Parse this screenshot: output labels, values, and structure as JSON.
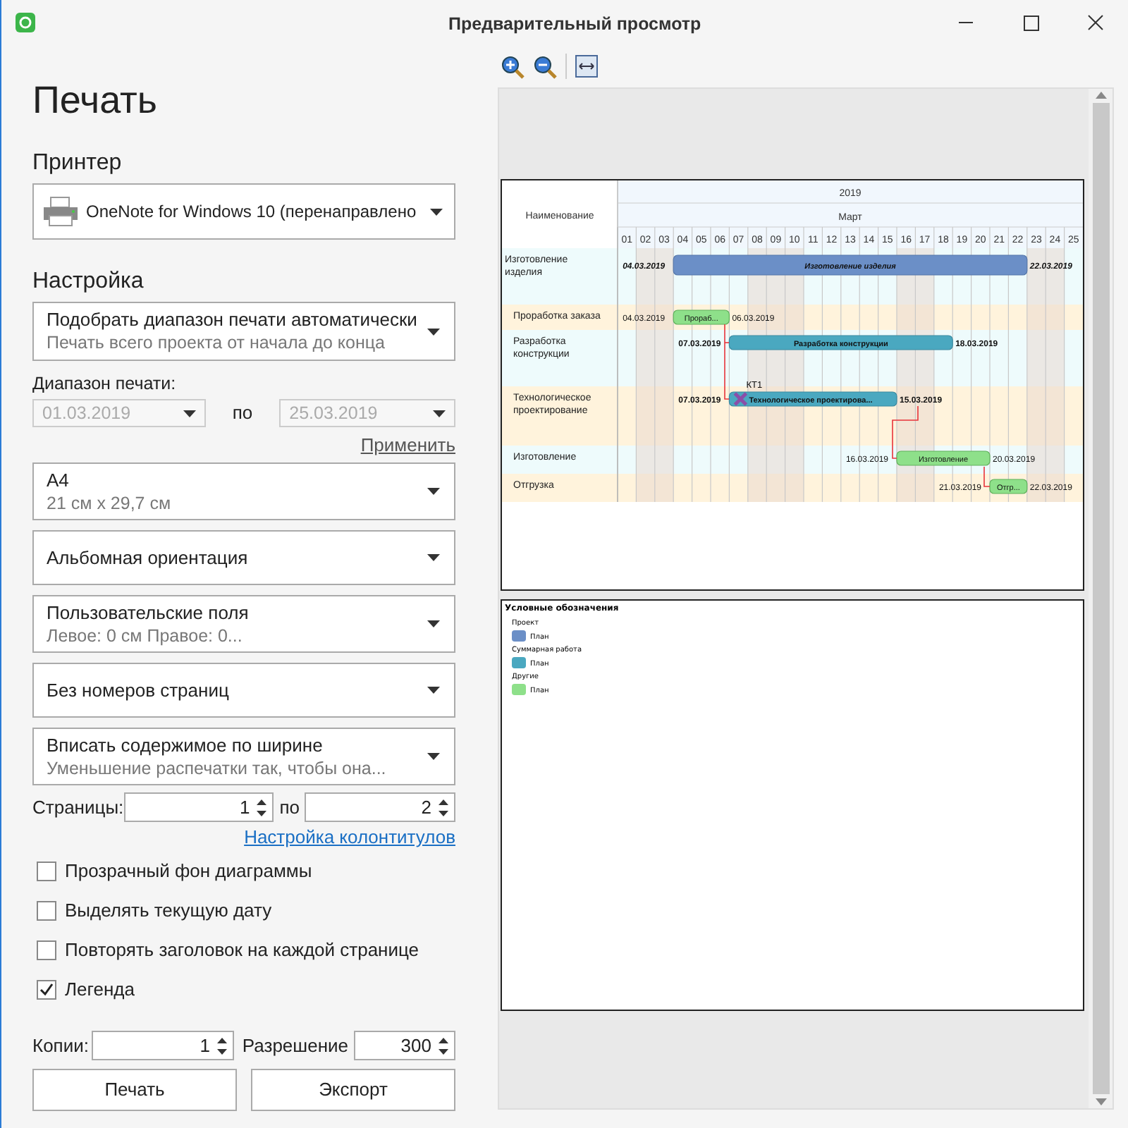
{
  "window": {
    "title": "Предварительный просмотр"
  },
  "panel": {
    "heading": "Печать",
    "printer_label": "Принтер",
    "printer": "OneNote for Windows 10 (перенаправлено",
    "settings_label": "Настройка",
    "scope": {
      "title": "Подобрать диапазон печати автоматически",
      "subtitle": "Печать всего проекта от начала до конца"
    },
    "range": {
      "label": "Диапазон печати:",
      "from": "01.03.2019",
      "separator": "по",
      "to": "25.03.2019",
      "disabled": true
    },
    "apply_link": "Применить",
    "dropdowns": [
      {
        "title": "A4",
        "subtitle": "21 см x 29,7 см"
      },
      {
        "title": "Альбомная ориентация"
      },
      {
        "title": "Пользовательские поля",
        "subtitle": "Левое:  0 см    Правое:  0..."
      },
      {
        "title": "Без номеров страниц"
      },
      {
        "title": "Вписать содержимое по ширине",
        "subtitle": "Уменьшение распечатки так, чтобы она..."
      }
    ],
    "pages": {
      "label": "Страницы:",
      "from": "1",
      "separator": "по",
      "to": "2"
    },
    "headers_link": "Настройка колонтитулов",
    "checkboxes": [
      {
        "label": "Прозрачный фон диаграммы",
        "checked": false
      },
      {
        "label": "Выделять текущую дату",
        "checked": false
      },
      {
        "label": "Повторять заголовок на каждой странице",
        "checked": false
      },
      {
        "label": "Легенда",
        "checked": true
      }
    ],
    "copies": {
      "label": "Копии:",
      "value": "1"
    },
    "resolution": {
      "label": "Разрешение",
      "value": "300"
    },
    "buttons": [
      "Печать",
      "Экспорт"
    ]
  },
  "preview": {
    "gantt": {
      "name_header": "Наименование",
      "year": "2019",
      "month": "Март",
      "days": [
        "01",
        "02",
        "03",
        "04",
        "05",
        "06",
        "07",
        "08",
        "09",
        "10",
        "11",
        "12",
        "13",
        "14",
        "15",
        "16",
        "17",
        "18",
        "19",
        "20",
        "21",
        "22",
        "23",
        "24",
        "25"
      ],
      "tasks": [
        {
          "kind": "project",
          "name": "Изготовление изделия",
          "start": "04.03.2019",
          "label": "Изготовление изделия",
          "end": "22.03.2019"
        },
        {
          "kind": "task",
          "name": "Проработка заказа",
          "start": "04.03.2019",
          "label": "Прораб...",
          "end": "06.03.2019"
        },
        {
          "kind": "summary",
          "name": "Разработка конструкции",
          "start": "07.03.2019",
          "label": "Разработка конструкции",
          "end": "18.03.2019"
        },
        {
          "kind": "summary",
          "name": "Технологическое проектирование",
          "start": "07.03.2019",
          "label": "Технологическое проектирова...",
          "end": "15.03.2019",
          "milestone": "КТ1"
        },
        {
          "kind": "task",
          "name": "Изготовление",
          "start": "16.03.2019",
          "label": "Изготовление",
          "end": "20.03.2019"
        },
        {
          "kind": "task",
          "name": "Отгрузка",
          "start": "21.03.2019",
          "label": "Отгр...",
          "end": "22.03.2019"
        }
      ]
    },
    "legend": {
      "title": "Условные обозначения",
      "groups": [
        {
          "name": "Проект",
          "item": "План",
          "color": "#6b8fc7"
        },
        {
          "name": "Суммарная работа",
          "item": "План",
          "color": "#4aa8c0"
        },
        {
          "name": "Другие",
          "item": "План",
          "color": "#8ee08a"
        }
      ]
    }
  }
}
